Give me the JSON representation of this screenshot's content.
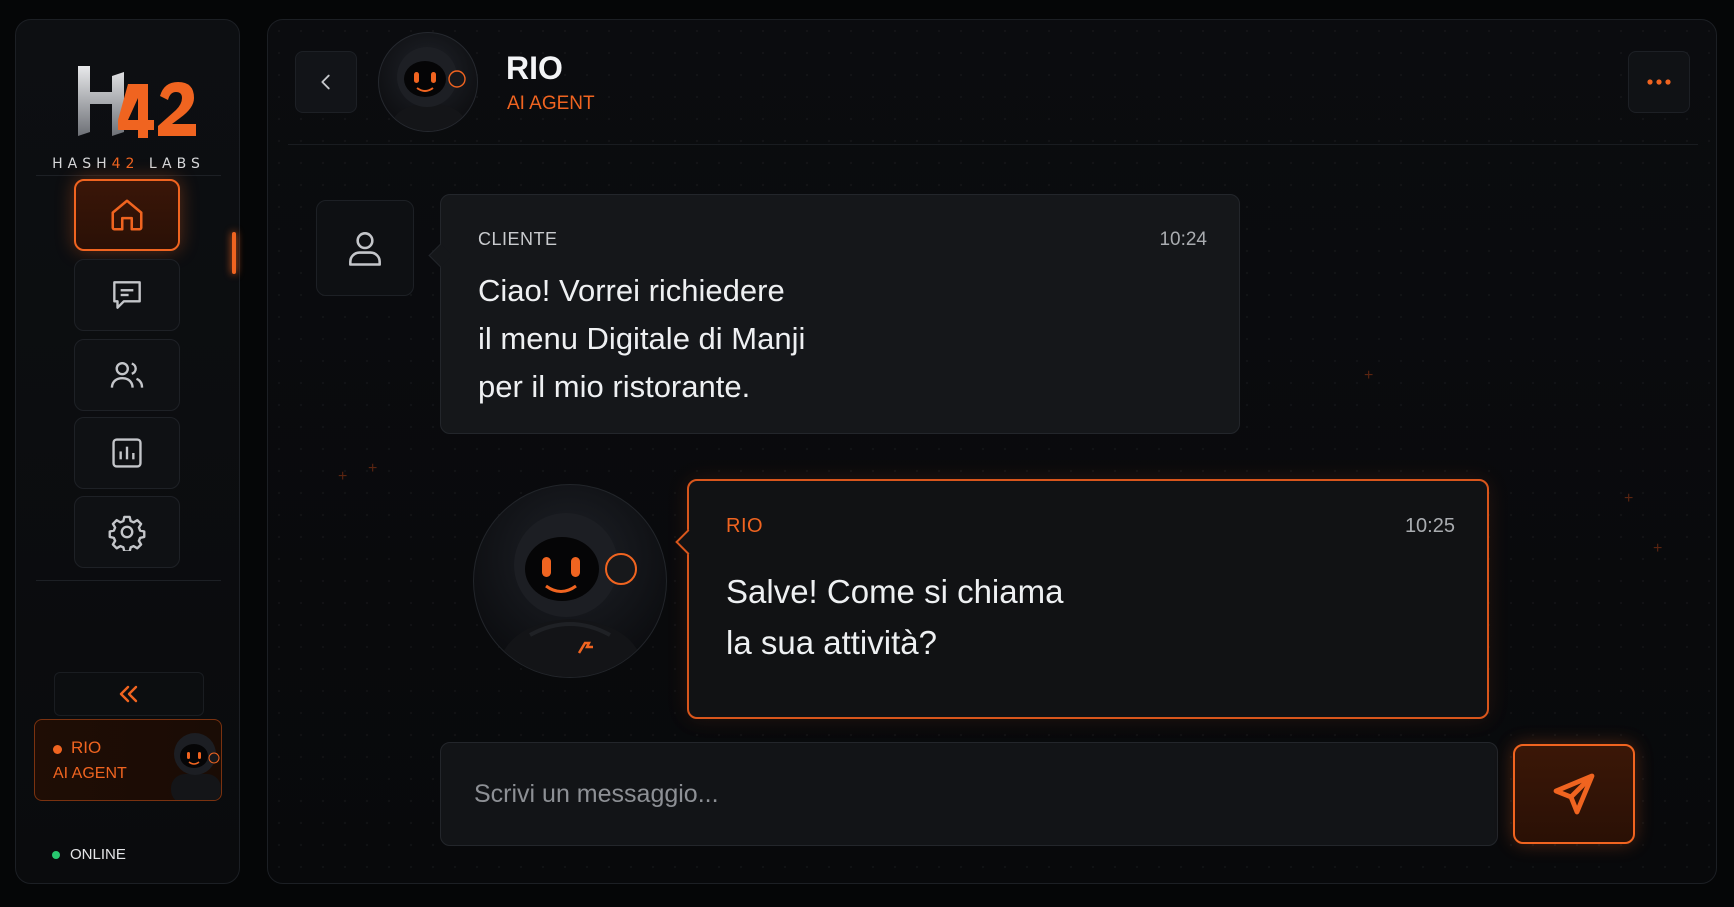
{
  "brand": {
    "logo_mark": "H42",
    "name_part1": "HASH",
    "name_accent": "42",
    "name_part2": " LABS"
  },
  "sidebar": {
    "nav": [
      {
        "name": "home",
        "icon": "home-icon",
        "active": true
      },
      {
        "name": "chat",
        "icon": "chat-icon",
        "active": false
      },
      {
        "name": "users",
        "icon": "users-icon",
        "active": false
      },
      {
        "name": "analytics",
        "icon": "bar-chart-icon",
        "active": false
      },
      {
        "name": "settings",
        "icon": "gear-icon",
        "active": false
      }
    ],
    "collapse_icon": "double-chevron-left-icon",
    "agent_card": {
      "name": "RIO",
      "role": "AI AGENT"
    },
    "status": "ONLINE"
  },
  "header": {
    "name": "RIO",
    "role": "AI AGENT"
  },
  "messages": [
    {
      "sender": "CLIENTE",
      "time": "10:24",
      "text": "Ciao! Vorrei richiedere\nil menu Digitale di Manji\nper il mio ristorante."
    },
    {
      "sender": "RIO",
      "time": "10:25",
      "text": "Salve! Come si chiama\nla sua attività?"
    }
  ],
  "composer": {
    "placeholder": "Scrivi un messaggio..."
  },
  "colors": {
    "accent": "#f06420",
    "background": "#050607",
    "online": "#28c76f"
  }
}
